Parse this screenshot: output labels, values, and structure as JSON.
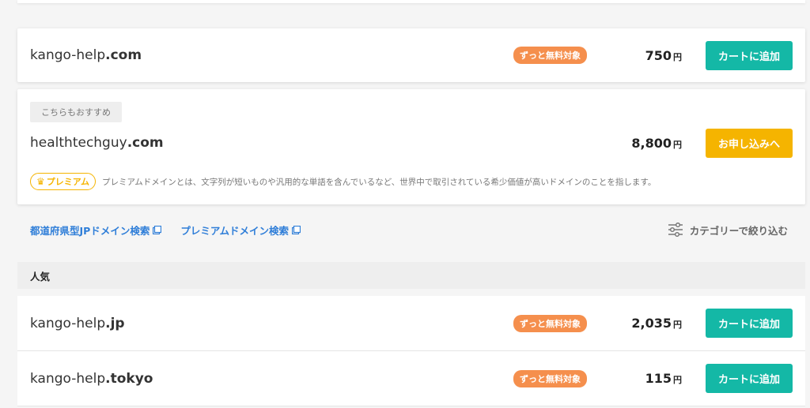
{
  "featured": {
    "domain_name": "kango-help",
    "domain_tld": ".com",
    "badge": "ずっと無料対象",
    "price": "750",
    "yen": "円",
    "button": "カートに追加"
  },
  "suggestion": {
    "tag": "こちらもおすすめ",
    "domain_name": "healthtechguy",
    "domain_tld": ".com",
    "price": "8,800",
    "yen": "円",
    "button": "お申し込みへ",
    "premium_label": "プレミアム",
    "premium_desc": "プレミアムドメインとは、文字列が短いものや汎用的な単語を含んでいるなど、世界中で取引されている希少価値が高いドメインのことを指します。"
  },
  "links": {
    "jp_prefecture": "都道府県型JPドメイン検索",
    "premium": "プレミアムドメイン検索",
    "filter": "カテゴリーで絞り込む"
  },
  "section": {
    "title": "人気"
  },
  "popular": [
    {
      "domain_name": "kango-help",
      "domain_tld": ".jp",
      "badge": "ずっと無料対象",
      "price": "2,035",
      "yen": "円",
      "button": "カートに追加"
    },
    {
      "domain_name": "kango-help",
      "domain_tld": ".tokyo",
      "badge": "ずっと無料対象",
      "price": "115",
      "yen": "円",
      "button": "カートに追加"
    }
  ],
  "colors": {
    "accent_teal": "#14b8a6",
    "accent_yellow": "#f5b400",
    "badge_orange": "#f58f4d",
    "link_blue": "#2f7ed8"
  }
}
